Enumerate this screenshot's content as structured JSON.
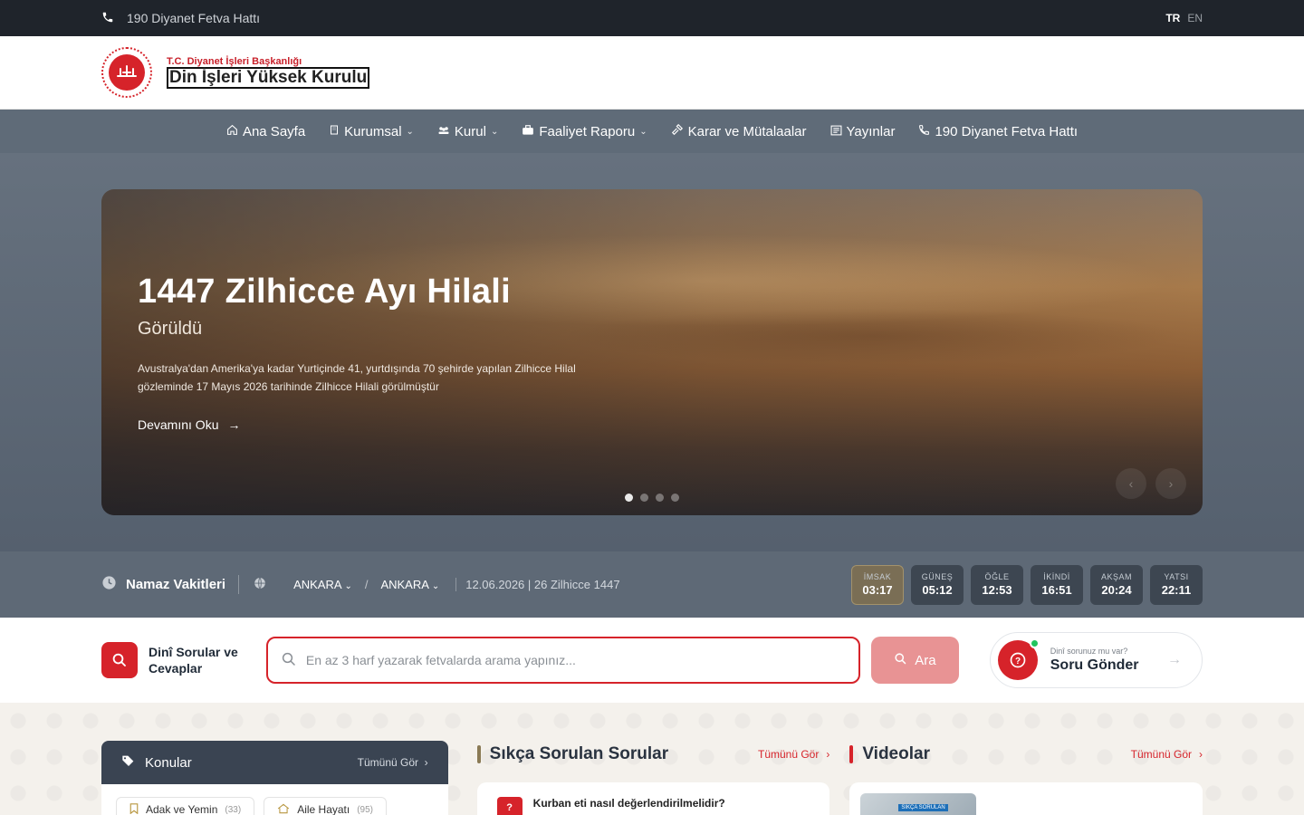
{
  "topbar": {
    "hotline": "190 Diyanet Fetva Hattı",
    "lang_tr": "TR",
    "lang_en": "EN"
  },
  "header": {
    "subtitle": "T.C. Diyanet İşleri Başkanlığı",
    "title": "Din İşleri Yüksek Kurulu"
  },
  "nav": {
    "items": [
      {
        "label": "Ana Sayfa",
        "icon": "home-icon",
        "dropdown": false
      },
      {
        "label": "Kurumsal",
        "icon": "building-icon",
        "dropdown": true
      },
      {
        "label": "Kurul",
        "icon": "users-icon",
        "dropdown": true
      },
      {
        "label": "Faaliyet Raporu",
        "icon": "briefcase-icon",
        "dropdown": true
      },
      {
        "label": "Karar ve Mütalaalar",
        "icon": "gavel-icon",
        "dropdown": false
      },
      {
        "label": "Yayınlar",
        "icon": "newspaper-icon",
        "dropdown": false
      },
      {
        "label": "190 Diyanet Fetva Hattı",
        "icon": "phone-icon",
        "dropdown": false
      }
    ]
  },
  "hero": {
    "title": "1447 Zilhicce Ayı Hilali",
    "subtitle": "Görüldü",
    "description": "Avustralya'dan Amerika'ya kadar Yurtiçinde 41, yurtdışında 70 şehirde yapılan Zilhicce Hilal gözleminde 17 Mayıs 2026 tarihinde Zilhicce Hilali görülmüştür",
    "read_more": "Devamını Oku",
    "slide_count": 4,
    "active_slide": 1
  },
  "prayer": {
    "title": "Namaz Vakitleri",
    "city": "ANKARA",
    "district": "ANKARA",
    "separator": "/",
    "date": "12.06.2026 | 26 Zilhicce 1447",
    "times": [
      {
        "label": "İMSAK",
        "value": "03:17",
        "active": true
      },
      {
        "label": "GÜNEŞ",
        "value": "05:12",
        "active": false
      },
      {
        "label": "ÖĞLE",
        "value": "12:53",
        "active": false
      },
      {
        "label": "İKİNDİ",
        "value": "16:51",
        "active": false
      },
      {
        "label": "AKŞAM",
        "value": "20:24",
        "active": false
      },
      {
        "label": "YATSI",
        "value": "22:11",
        "active": false
      }
    ]
  },
  "search": {
    "section_label_1": "Dinî Sorular ve",
    "section_label_2": "Cevaplar",
    "placeholder": "En az 3 harf yazarak fetvalarda arama yapınız...",
    "button": "Ara",
    "ask_small": "Dinî sorunuz mu var?",
    "ask_big": "Soru Gönder"
  },
  "konular": {
    "title": "Konular",
    "all": "Tümünü Gör",
    "chips": [
      {
        "label": "Adak ve Yemin",
        "count": "(33)"
      },
      {
        "label": "Aile Hayatı",
        "count": "(95)"
      }
    ]
  },
  "faq": {
    "title": "Sıkça Sorulan Sorular",
    "all": "Tümünü Gör",
    "first_question": "Kurban eti nasıl değerlendirilmelidir?",
    "badge": "?"
  },
  "videos": {
    "title": "Videolar",
    "all": "Tümünü Gör",
    "thumb_tag": "SIKÇA SORULAN"
  },
  "colors": {
    "brand_red": "#d6232a",
    "nav_bg": "#5f6b78",
    "topbar_bg": "#1f242b",
    "faq_bar": "#8a7a55",
    "video_bar": "#d6232a"
  }
}
